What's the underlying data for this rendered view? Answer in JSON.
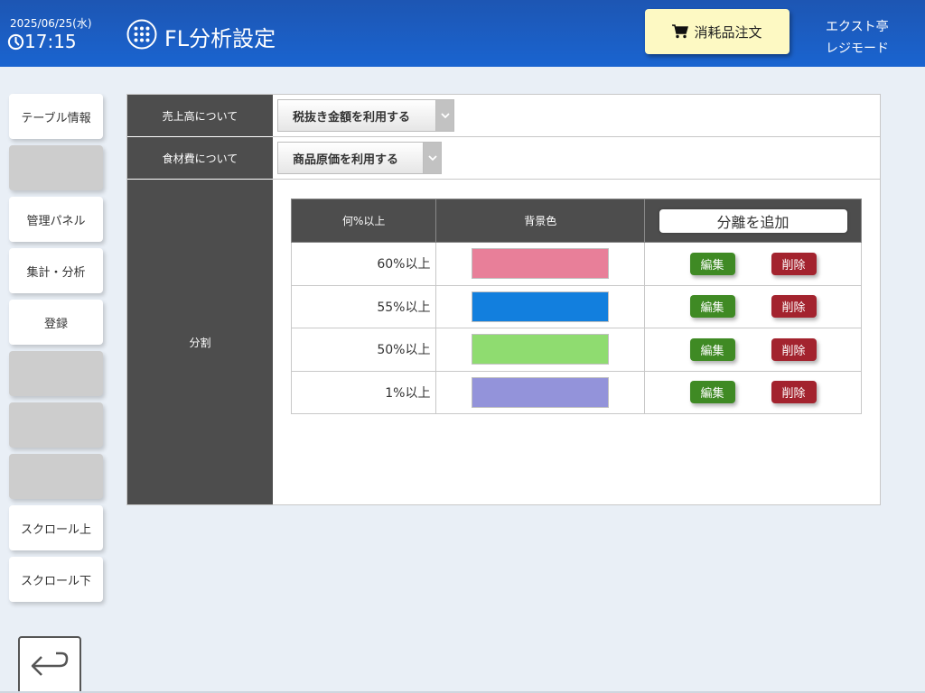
{
  "header": {
    "date": "2025/06/25(水)",
    "time": "17:15",
    "title": "FL分析設定",
    "order_button": "消耗品注文",
    "shop_name": "エクスト亭",
    "mode": "レジモード",
    "colors": {
      "header_bg": "#1a5fc4",
      "order_bg": "#fdf9c3"
    }
  },
  "sidebar": {
    "items": [
      {
        "label": "テーブル情報"
      },
      {
        "label": ""
      },
      {
        "label": "管理パネル"
      },
      {
        "label": "集計・分析"
      },
      {
        "label": "登録"
      },
      {
        "label": ""
      },
      {
        "label": ""
      },
      {
        "label": ""
      },
      {
        "label": "スクロール上"
      },
      {
        "label": "スクロール下"
      }
    ],
    "back_icon": "return-arrow-icon"
  },
  "settings": {
    "sales": {
      "label": "売上高について",
      "value": "税抜き金額を利用する"
    },
    "food": {
      "label": "食材費について",
      "value": "商品原価を利用する"
    },
    "division": {
      "label": "分割"
    }
  },
  "table": {
    "headers": {
      "threshold": "何%以上",
      "color": "背景色",
      "add_button": "分離を追加"
    },
    "rows": [
      {
        "threshold": "60%以上",
        "color": "#e87f99",
        "edit": "編集",
        "delete": "削除"
      },
      {
        "threshold": "55%以上",
        "color": "#127fde",
        "edit": "編集",
        "delete": "削除"
      },
      {
        "threshold": "50%以上",
        "color": "#8fdc70",
        "edit": "編集",
        "delete": "削除"
      },
      {
        "threshold": "1%以上",
        "color": "#9393da",
        "edit": "編集",
        "delete": "削除"
      }
    ]
  }
}
